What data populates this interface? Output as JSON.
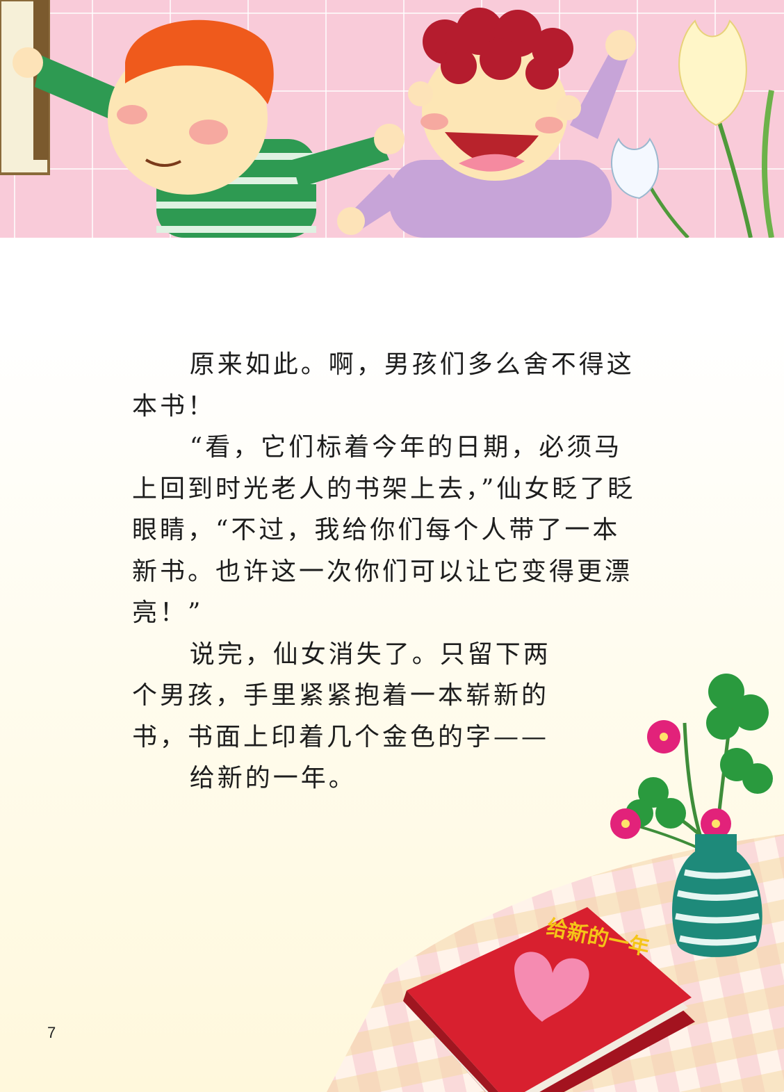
{
  "story": {
    "paragraphs": [
      "原来如此。啊，男孩们多么舍不得这本书！",
      "“看，它们标着今年的日期，必须马上回到时光老人的书架上去，”仙女眨了眨眼睛，“不过，我给你们每个人带了一本新书。也许这一次你们可以让它变得更漂亮！”",
      "说完，仙女消失了。只留下两个男孩，手里紧紧抱着一本崭新的书，书面上印着几个金色的字——",
      "给新的一年。"
    ]
  },
  "illustration": {
    "book_cover_title": "给新的一年"
  },
  "page_number": "7",
  "colors": {
    "banner_pink": "#f9cbd9",
    "book_red": "#d8202f",
    "book_title_gold": "#f5c518",
    "vase_teal": "#1e8a7a"
  }
}
